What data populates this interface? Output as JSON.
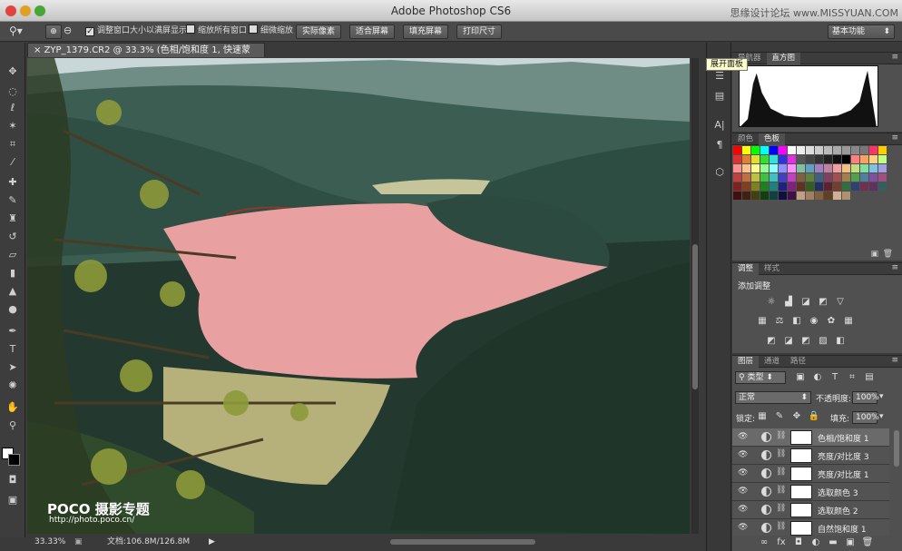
{
  "window": {
    "title": "Adobe Photoshop CS6",
    "watermark": "思缘设计论坛 www.MISSYUAN.COM"
  },
  "options": {
    "resize_windows": "调整窗口大小以满屏显示",
    "zoom_all": "缩放所有窗口",
    "scrubby_zoom": "细微缩放",
    "actual_pixels": "实际像素",
    "fit_screen": "适合屏幕",
    "fill_screen": "填充屏幕",
    "print_size": "打印尺寸",
    "workspace": "基本功能"
  },
  "document": {
    "tab_title": "ZYP_1379.CR2 @ 33.3% (色相/饱和度 1, 快速蒙版/16) *",
    "close": "×"
  },
  "status": {
    "zoom": "33.33%",
    "doc_size": "文档:106.8M/126.8M"
  },
  "image": {
    "watermark_brand": "POCO 摄影专题",
    "watermark_url": "http://photo.poco.cn/"
  },
  "dock": {
    "tooltip": "展开面板"
  },
  "panels": {
    "top": {
      "tabs": [
        "导航器",
        "直方图"
      ],
      "active": 1
    },
    "color": {
      "tabs": [
        "颜色",
        "色板"
      ],
      "active": 1
    },
    "adjust": {
      "tabs": [
        "调整",
        "样式"
      ],
      "active": 0,
      "heading": "添加调整"
    },
    "layers": {
      "tabs": [
        "图层",
        "通道",
        "路径"
      ],
      "active": 0,
      "filter": "类型",
      "blend_mode": "正常",
      "opacity_label": "不透明度:",
      "opacity": "100%",
      "lock_label": "锁定:",
      "fill_label": "填充:",
      "fill": "100%",
      "items": [
        {
          "name": "色相/饱和度 1",
          "selected": true
        },
        {
          "name": "亮度/对比度 3",
          "selected": false
        },
        {
          "name": "亮度/对比度 1",
          "selected": false
        },
        {
          "name": "选取颜色 3",
          "selected": false
        },
        {
          "name": "选取颜色 2",
          "selected": false
        },
        {
          "name": "自然饱和度 1",
          "selected": false
        }
      ]
    }
  },
  "colors": {
    "accent": "#e8a0a0",
    "panel": "#505050"
  }
}
